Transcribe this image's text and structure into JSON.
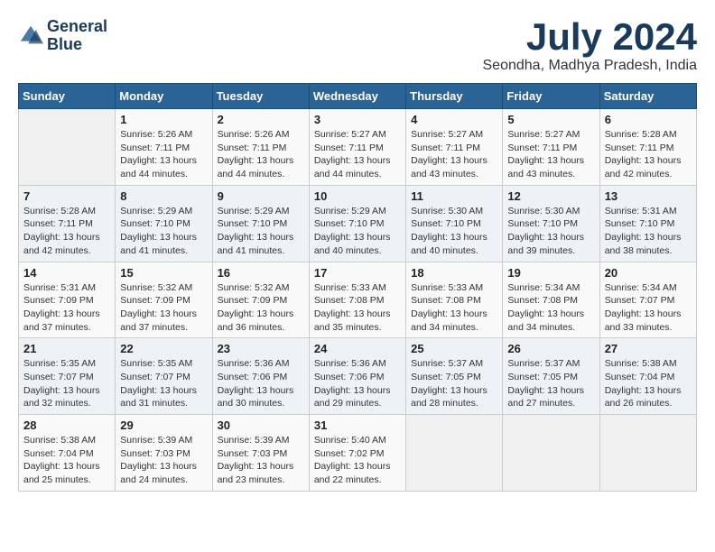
{
  "header": {
    "logo_line1": "General",
    "logo_line2": "Blue",
    "month_year": "July 2024",
    "location": "Seondha, Madhya Pradesh, India"
  },
  "weekdays": [
    "Sunday",
    "Monday",
    "Tuesday",
    "Wednesday",
    "Thursday",
    "Friday",
    "Saturday"
  ],
  "weeks": [
    [
      {
        "day": "",
        "sunrise": "",
        "sunset": "",
        "daylight": ""
      },
      {
        "day": "1",
        "sunrise": "5:26 AM",
        "sunset": "7:11 PM",
        "daylight": "13 hours and 44 minutes."
      },
      {
        "day": "2",
        "sunrise": "5:26 AM",
        "sunset": "7:11 PM",
        "daylight": "13 hours and 44 minutes."
      },
      {
        "day": "3",
        "sunrise": "5:27 AM",
        "sunset": "7:11 PM",
        "daylight": "13 hours and 44 minutes."
      },
      {
        "day": "4",
        "sunrise": "5:27 AM",
        "sunset": "7:11 PM",
        "daylight": "13 hours and 43 minutes."
      },
      {
        "day": "5",
        "sunrise": "5:27 AM",
        "sunset": "7:11 PM",
        "daylight": "13 hours and 43 minutes."
      },
      {
        "day": "6",
        "sunrise": "5:28 AM",
        "sunset": "7:11 PM",
        "daylight": "13 hours and 42 minutes."
      }
    ],
    [
      {
        "day": "7",
        "sunrise": "5:28 AM",
        "sunset": "7:11 PM",
        "daylight": "13 hours and 42 minutes."
      },
      {
        "day": "8",
        "sunrise": "5:29 AM",
        "sunset": "7:10 PM",
        "daylight": "13 hours and 41 minutes."
      },
      {
        "day": "9",
        "sunrise": "5:29 AM",
        "sunset": "7:10 PM",
        "daylight": "13 hours and 41 minutes."
      },
      {
        "day": "10",
        "sunrise": "5:29 AM",
        "sunset": "7:10 PM",
        "daylight": "13 hours and 40 minutes."
      },
      {
        "day": "11",
        "sunrise": "5:30 AM",
        "sunset": "7:10 PM",
        "daylight": "13 hours and 40 minutes."
      },
      {
        "day": "12",
        "sunrise": "5:30 AM",
        "sunset": "7:10 PM",
        "daylight": "13 hours and 39 minutes."
      },
      {
        "day": "13",
        "sunrise": "5:31 AM",
        "sunset": "7:10 PM",
        "daylight": "13 hours and 38 minutes."
      }
    ],
    [
      {
        "day": "14",
        "sunrise": "5:31 AM",
        "sunset": "7:09 PM",
        "daylight": "13 hours and 37 minutes."
      },
      {
        "day": "15",
        "sunrise": "5:32 AM",
        "sunset": "7:09 PM",
        "daylight": "13 hours and 37 minutes."
      },
      {
        "day": "16",
        "sunrise": "5:32 AM",
        "sunset": "7:09 PM",
        "daylight": "13 hours and 36 minutes."
      },
      {
        "day": "17",
        "sunrise": "5:33 AM",
        "sunset": "7:08 PM",
        "daylight": "13 hours and 35 minutes."
      },
      {
        "day": "18",
        "sunrise": "5:33 AM",
        "sunset": "7:08 PM",
        "daylight": "13 hours and 34 minutes."
      },
      {
        "day": "19",
        "sunrise": "5:34 AM",
        "sunset": "7:08 PM",
        "daylight": "13 hours and 34 minutes."
      },
      {
        "day": "20",
        "sunrise": "5:34 AM",
        "sunset": "7:07 PM",
        "daylight": "13 hours and 33 minutes."
      }
    ],
    [
      {
        "day": "21",
        "sunrise": "5:35 AM",
        "sunset": "7:07 PM",
        "daylight": "13 hours and 32 minutes."
      },
      {
        "day": "22",
        "sunrise": "5:35 AM",
        "sunset": "7:07 PM",
        "daylight": "13 hours and 31 minutes."
      },
      {
        "day": "23",
        "sunrise": "5:36 AM",
        "sunset": "7:06 PM",
        "daylight": "13 hours and 30 minutes."
      },
      {
        "day": "24",
        "sunrise": "5:36 AM",
        "sunset": "7:06 PM",
        "daylight": "13 hours and 29 minutes."
      },
      {
        "day": "25",
        "sunrise": "5:37 AM",
        "sunset": "7:05 PM",
        "daylight": "13 hours and 28 minutes."
      },
      {
        "day": "26",
        "sunrise": "5:37 AM",
        "sunset": "7:05 PM",
        "daylight": "13 hours and 27 minutes."
      },
      {
        "day": "27",
        "sunrise": "5:38 AM",
        "sunset": "7:04 PM",
        "daylight": "13 hours and 26 minutes."
      }
    ],
    [
      {
        "day": "28",
        "sunrise": "5:38 AM",
        "sunset": "7:04 PM",
        "daylight": "13 hours and 25 minutes."
      },
      {
        "day": "29",
        "sunrise": "5:39 AM",
        "sunset": "7:03 PM",
        "daylight": "13 hours and 24 minutes."
      },
      {
        "day": "30",
        "sunrise": "5:39 AM",
        "sunset": "7:03 PM",
        "daylight": "13 hours and 23 minutes."
      },
      {
        "day": "31",
        "sunrise": "5:40 AM",
        "sunset": "7:02 PM",
        "daylight": "13 hours and 22 minutes."
      },
      {
        "day": "",
        "sunrise": "",
        "sunset": "",
        "daylight": ""
      },
      {
        "day": "",
        "sunrise": "",
        "sunset": "",
        "daylight": ""
      },
      {
        "day": "",
        "sunrise": "",
        "sunset": "",
        "daylight": ""
      }
    ]
  ]
}
